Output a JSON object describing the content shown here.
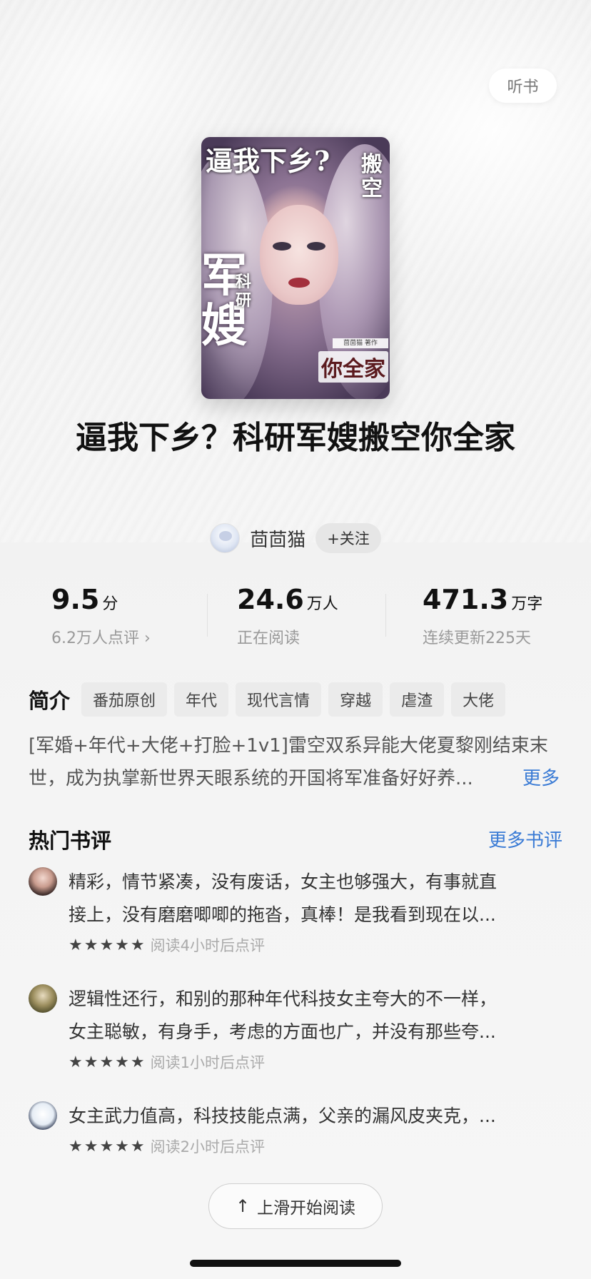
{
  "top": {
    "listen_label": "听书"
  },
  "cover": {
    "text_top_left": "逼我下乡?",
    "text_top_right": "搬空",
    "text_big": "军嫂",
    "text_small": "科研",
    "text_bottom": "你全家",
    "author_strip": "茴茴猫 著作"
  },
  "book": {
    "title": "逼我下乡？科研军嫂搬空你全家"
  },
  "author": {
    "name": "茴茴猫",
    "follow_label": "+关注"
  },
  "stats": {
    "score": {
      "value": "9.5",
      "unit": "分",
      "sub": "6.2万人点评 ›"
    },
    "readers": {
      "value": "24.6",
      "unit": "万人",
      "sub": "正在阅读"
    },
    "words": {
      "value": "471.3",
      "unit": "万字",
      "sub": "连续更新225天"
    }
  },
  "intro": {
    "label": "简介",
    "tags": [
      "番茄原创",
      "年代",
      "现代言情",
      "穿越",
      "虐渣",
      "大佬"
    ],
    "line1": "[军婚+年代+大佬+打脸+1v1]雷空双系异能大佬夏黎刚结束末",
    "line2": "世，成为执掌新世界天眼系统的开国将军准备好好养...",
    "more_label": "更多"
  },
  "reviews": {
    "title": "热门书评",
    "more_label": "更多书评",
    "items": [
      {
        "line1": "精彩，情节紧凑，没有废话，女主也够强大，有事就直",
        "line2": "接上，没有磨磨唧唧的拖沓，真棒！是我看到现在以...",
        "stars": "★★★★★",
        "when": "阅读4小时后点评"
      },
      {
        "line1": "逻辑性还行，和别的那种年代科技女主夸大的不一样，",
        "line2": "女主聪敏，有身手，考虑的方面也广，并没有那些夸...",
        "stars": "★★★★★",
        "when": "阅读1小时后点评"
      },
      {
        "line1": "女主武力值高，科技技能点满，父亲的漏风皮夹克，...",
        "stars": "★★★★★",
        "when": "阅读2小时后点评"
      }
    ]
  },
  "start": {
    "arrow": "↑",
    "label": "上滑开始阅读"
  }
}
